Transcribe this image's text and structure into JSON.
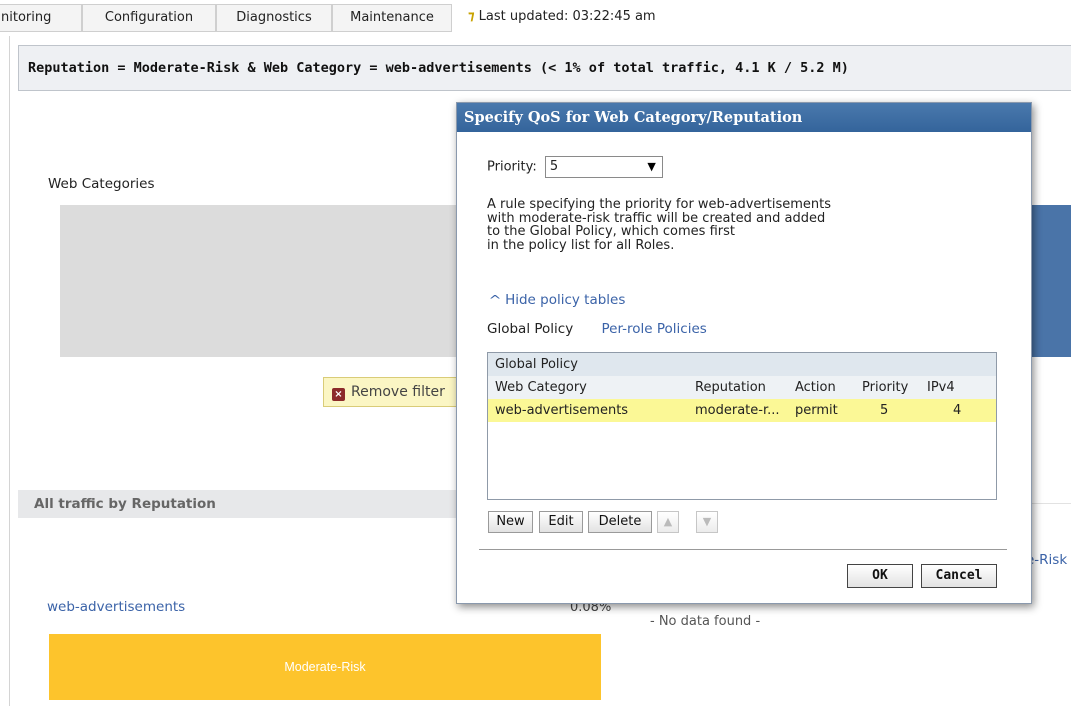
{
  "tabs": [
    {
      "label": "nitoring"
    },
    {
      "label": "Configuration"
    },
    {
      "label": "Diagnostics"
    },
    {
      "label": "Maintenance"
    }
  ],
  "status": {
    "last_updated": "Last updated: 03:22:45 am",
    "icon": "pin-icon"
  },
  "filter": {
    "text": "Reputation = Moderate-Risk & Web Category = web-advertisements (< 1% of total traffic, 4.1 K / 5.2 M)"
  },
  "background": {
    "web_categories_label": "Web Categories",
    "remove_filter_label": "Remove filter",
    "reputation_header": "All traffic by Reputation",
    "right_risk_label": "e-Risk",
    "web_ads_link": "web-advertisements",
    "percent": "0.08%",
    "no_data": "- No data found -",
    "bar_label": "Moderate-Risk",
    "colors": {
      "bar": "#fdc42c",
      "chart_blue": "#4a74a8",
      "gray": "#dcdcdc"
    }
  },
  "dialog": {
    "title": "Specify QoS for Web Category/Reputation",
    "priority_label": "Priority:",
    "priority_value": "5",
    "rule_text": "A rule specifying the priority for web-advertisements\nwith moderate-risk traffic will be created and added\nto the Global Policy, which comes first\nin the policy list for all Roles.",
    "hide_tables": "Hide policy tables",
    "policy_tab_global": "Global Policy",
    "policy_tab_per_role": "Per-role Policies",
    "table": {
      "title": "Global Policy",
      "columns": [
        "Web Category",
        "Reputation",
        "Action",
        "Priority",
        "IPv4"
      ],
      "rows": [
        {
          "web_category": "web-advertisements",
          "reputation": "moderate-r...",
          "action": "permit",
          "priority": "5",
          "ipv4": "4"
        }
      ]
    },
    "buttons": {
      "new": "New",
      "edit": "Edit",
      "delete": "Delete",
      "ok": "OK",
      "cancel": "Cancel"
    }
  }
}
